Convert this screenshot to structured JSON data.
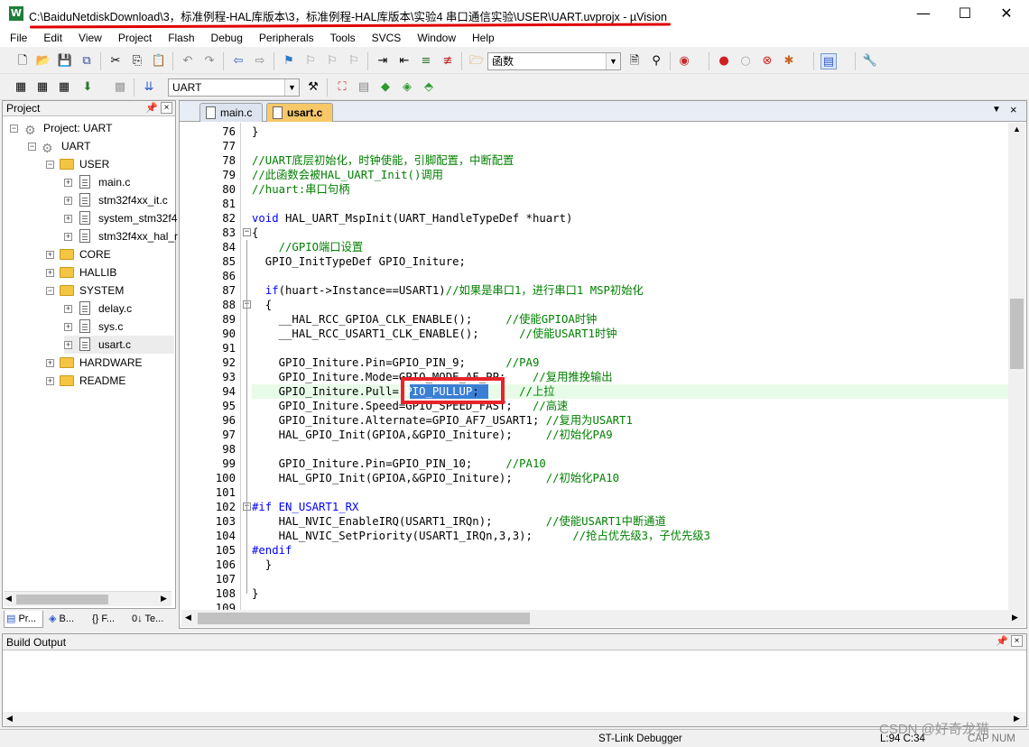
{
  "window": {
    "title": "C:\\BaiduNetdiskDownload\\3，标准例程-HAL库版本\\3，标准例程-HAL库版本\\实验4 串口通信实验\\USER\\UART.uvprojx - µVision",
    "app_icon": "W",
    "minimize": "—",
    "maximize": "☐",
    "close": "✕"
  },
  "menu": [
    "File",
    "Edit",
    "View",
    "Project",
    "Flash",
    "Debug",
    "Peripherals",
    "Tools",
    "SVCS",
    "Window",
    "Help"
  ],
  "toolbar1": {
    "find_label": "函数"
  },
  "toolbar2": {
    "target": "UART"
  },
  "project_panel": {
    "title": "Project",
    "pin": "⊞",
    "close": "×",
    "tree": [
      {
        "label": "Project: UART",
        "type": "project"
      },
      {
        "label": "UART",
        "type": "target"
      },
      {
        "label": "USER",
        "type": "folder"
      },
      {
        "label": "main.c",
        "type": "file"
      },
      {
        "label": "stm32f4xx_it.c",
        "type": "file"
      },
      {
        "label": "system_stm32f4",
        "type": "file"
      },
      {
        "label": "stm32f4xx_hal_r",
        "type": "file"
      },
      {
        "label": "CORE",
        "type": "folder"
      },
      {
        "label": "HALLIB",
        "type": "folder"
      },
      {
        "label": "SYSTEM",
        "type": "folder"
      },
      {
        "label": "delay.c",
        "type": "file"
      },
      {
        "label": "sys.c",
        "type": "file"
      },
      {
        "label": "usart.c",
        "type": "file"
      },
      {
        "label": "HARDWARE",
        "type": "folder"
      },
      {
        "label": "README",
        "type": "folder"
      }
    ],
    "tabs": [
      "Pr...",
      "B...",
      "{} F...",
      "0↓ Te..."
    ]
  },
  "editor": {
    "tabs": [
      {
        "label": "main.c",
        "active": false
      },
      {
        "label": "usart.c",
        "active": true
      }
    ],
    "current_line": 94,
    "lines": [
      {
        "n": "76",
        "code": "}"
      },
      {
        "n": "77",
        "code": ""
      },
      {
        "n": "78",
        "code": "//UART底层初始化，时钟使能，引脚配置，中断配置"
      },
      {
        "n": "79",
        "code": "//此函数会被HAL_UART_Init()调用"
      },
      {
        "n": "80",
        "code": "//huart:串口句柄"
      },
      {
        "n": "81",
        "code": ""
      },
      {
        "n": "82",
        "code": "void HAL_UART_MspInit(UART_HandleTypeDef *huart)"
      },
      {
        "n": "83",
        "code": "{"
      },
      {
        "n": "84",
        "code": "    //GPIO端口设置"
      },
      {
        "n": "85",
        "code": "  GPIO_InitTypeDef GPIO_Initure;"
      },
      {
        "n": "86",
        "code": ""
      },
      {
        "n": "87",
        "code": "  if(huart->Instance==USART1)//如果是串口1，进行串口1 MSP初始化"
      },
      {
        "n": "88",
        "code": "  {"
      },
      {
        "n": "89",
        "code": "    __HAL_RCC_GPIOA_CLK_ENABLE();     //使能GPIOA时钟"
      },
      {
        "n": "90",
        "code": "    __HAL_RCC_USART1_CLK_ENABLE();      //使能USART1时钟"
      },
      {
        "n": "91",
        "code": ""
      },
      {
        "n": "92",
        "code": "    GPIO_Initure.Pin=GPIO_PIN_9;      //PA9"
      },
      {
        "n": "93",
        "code": "    GPIO_Initure.Mode=GPIO_MODE_AF_PP;    //复用推挽输出"
      },
      {
        "n": "94",
        "code": "    GPIO_Initure.Pull=GPIO_PULLUP;      //上拉"
      },
      {
        "n": "95",
        "code": "    GPIO_Initure.Speed=GPIO_SPEED_FAST;   //高速"
      },
      {
        "n": "96",
        "code": "    GPIO_Initure.Alternate=GPIO_AF7_USART1; //复用为USART1"
      },
      {
        "n": "97",
        "code": "    HAL_GPIO_Init(GPIOA,&GPIO_Initure);     //初始化PA9"
      },
      {
        "n": "98",
        "code": ""
      },
      {
        "n": "99",
        "code": "    GPIO_Initure.Pin=GPIO_PIN_10;     //PA10"
      },
      {
        "n": "100",
        "code": "    HAL_GPIO_Init(GPIOA,&GPIO_Initure);     //初始化PA10"
      },
      {
        "n": "101",
        "code": ""
      },
      {
        "n": "102",
        "code": "#if EN_USART1_RX"
      },
      {
        "n": "103",
        "code": "    HAL_NVIC_EnableIRQ(USART1_IRQn);        //使能USART1中断通道"
      },
      {
        "n": "104",
        "code": "    HAL_NVIC_SetPriority(USART1_IRQn,3,3);      //抢占优先级3，子优先级3"
      },
      {
        "n": "105",
        "code": "#endif"
      },
      {
        "n": "106",
        "code": "  }"
      },
      {
        "n": "107",
        "code": ""
      },
      {
        "n": "108",
        "code": "}"
      },
      {
        "n": "109",
        "code": ""
      }
    ]
  },
  "build_output": {
    "title": "Build Output"
  },
  "status": {
    "debugger": "ST-Link Debugger",
    "position": "L:94 C:34",
    "caps": "CAP NUM"
  },
  "watermark": "CSDN @好奇龙猫",
  "colors": {
    "comment": "#008000",
    "keyword": "#0000ff",
    "highlight_box": "#e8232a",
    "selection": "#3a7fd4",
    "current_line": "#e8fbe8"
  }
}
